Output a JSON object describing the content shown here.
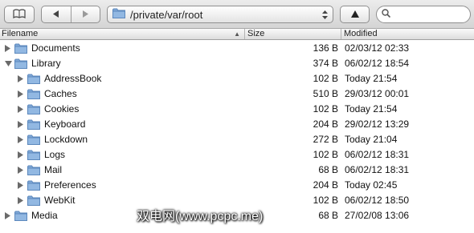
{
  "toolbar": {
    "path": "/private/var/root",
    "search_placeholder": "",
    "bookmarks_icon": "book-icon",
    "back_icon": "triangle-left-icon",
    "forward_icon": "triangle-right-icon",
    "up_icon": "triangle-up-icon"
  },
  "columns": {
    "name": "Filename",
    "size": "Size",
    "modified": "Modified"
  },
  "colors": {
    "folder": "#7fa8d6",
    "folder_dark": "#5c88bd"
  },
  "rows": [
    {
      "name": "Documents",
      "size": "136 B",
      "modified": "02/03/12 02:33",
      "expanded": false
    },
    {
      "name": "Library",
      "size": "374 B",
      "modified": "06/02/12 18:54",
      "expanded": true
    },
    {
      "name": "AddressBook",
      "size": "102 B",
      "modified": "Today 21:54",
      "expanded": false
    },
    {
      "name": "Caches",
      "size": "510 B",
      "modified": "29/03/12 00:01",
      "expanded": false
    },
    {
      "name": "Cookies",
      "size": "102 B",
      "modified": "Today 21:54",
      "expanded": false
    },
    {
      "name": "Keyboard",
      "size": "204 B",
      "modified": "29/02/12 13:29",
      "expanded": false
    },
    {
      "name": "Lockdown",
      "size": "272 B",
      "modified": "Today 21:04",
      "expanded": false
    },
    {
      "name": "Logs",
      "size": "102 B",
      "modified": "06/02/12 18:31",
      "expanded": false
    },
    {
      "name": "Mail",
      "size": "68 B",
      "modified": "06/02/12 18:31",
      "expanded": false
    },
    {
      "name": "Preferences",
      "size": "204 B",
      "modified": "Today 02:45",
      "expanded": false
    },
    {
      "name": "WebKit",
      "size": "102 B",
      "modified": "06/02/12 18:50",
      "expanded": false
    },
    {
      "name": "Media",
      "size": "68 B",
      "modified": "27/02/08 13:06",
      "expanded": false
    }
  ],
  "watermark": "双电网(www.pcpc.me)"
}
